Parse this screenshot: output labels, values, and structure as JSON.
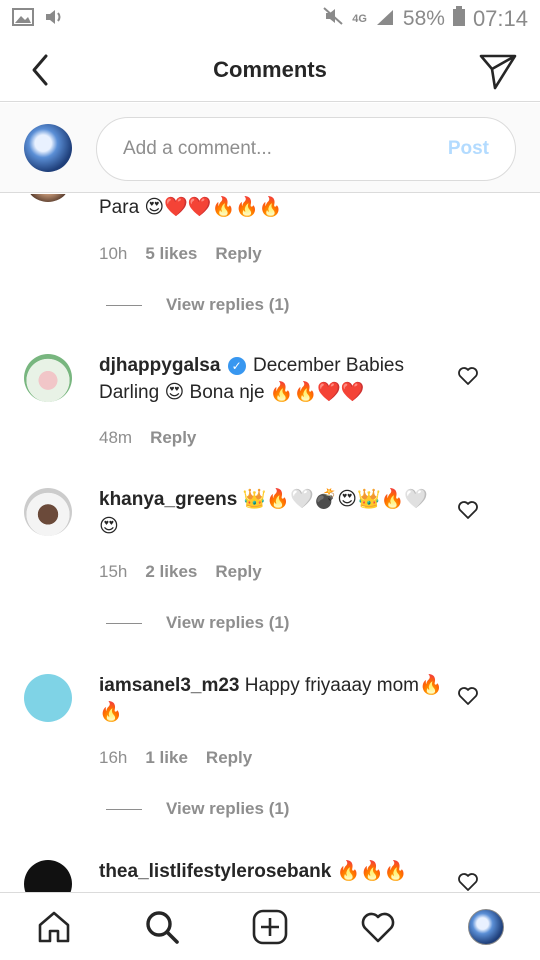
{
  "status_bar": {
    "network": "4G",
    "battery": "58%",
    "time": "07:14"
  },
  "header": {
    "title": "Comments"
  },
  "composer": {
    "placeholder": "Add a comment...",
    "post_label": "Post"
  },
  "comments": [
    {
      "text": "Para 😍❤️❤️🔥🔥🔥",
      "time": "10h",
      "likes": "5 likes",
      "reply_label": "Reply",
      "view_replies": "View replies (1)"
    },
    {
      "user": "djhappygalsa",
      "text": "December Babies Darling 😍 Bona nje 🔥🔥❤️❤️",
      "time": "48m",
      "reply_label": "Reply"
    },
    {
      "user": "khanya_greens",
      "text": "👑🔥🤍💣😍👑🔥🤍😍",
      "time": "15h",
      "likes": "2 likes",
      "reply_label": "Reply",
      "view_replies": "View replies (1)"
    },
    {
      "user": "iamsanel3_m23",
      "text": "Happy friyaaay mom🔥🔥",
      "time": "16h",
      "likes": "1 like",
      "reply_label": "Reply",
      "view_replies": "View replies (1)"
    },
    {
      "user": "thea_listlifestylerosebank",
      "text": "🔥🔥🔥"
    }
  ],
  "colors": {
    "accent": "#3897f0",
    "post_disabled": "#b3dbff",
    "muted": "#8e8e8e",
    "border": "#dbdbdb"
  }
}
